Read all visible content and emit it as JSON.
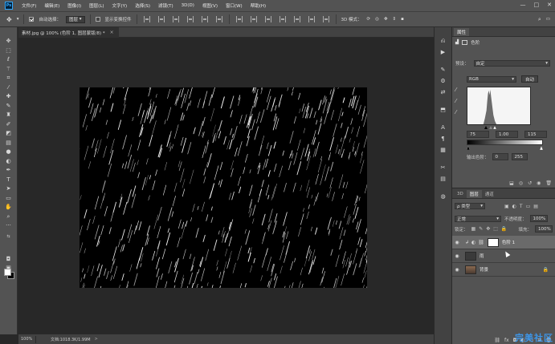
{
  "menubar": {
    "logo": "Ps",
    "items": [
      "文件(F)",
      "编辑(E)",
      "图像(I)",
      "图层(L)",
      "文字(Y)",
      "选择(S)",
      "滤镜(T)",
      "3D(D)",
      "视图(V)",
      "窗口(W)",
      "帮助(H)"
    ],
    "window_controls": [
      "—",
      "□",
      "✕"
    ]
  },
  "options": {
    "auto_select_label": "自动选择：",
    "auto_select_value": "图层",
    "show_transform_label": "显示变换控件",
    "mode_3d_label": "3D 模式："
  },
  "document": {
    "tab_title": "素材.jpg @ 100% (色阶 1, 图层蒙版/8) *",
    "close_glyph": "×"
  },
  "status": {
    "zoom": "100%",
    "doc_info": "文档:1018.3K/1.99M",
    "arrow": ">"
  },
  "properties": {
    "tab_label": "属性",
    "levels_title": "色阶",
    "preset_label": "预设：",
    "preset_value": "自定",
    "channel_value": "RGB",
    "auto_button": "自动",
    "input_black": "75",
    "input_gamma": "1.00",
    "input_white": "115",
    "output_label": "输出色阶：",
    "output_black": "0",
    "output_white": "255"
  },
  "layers": {
    "tabs": [
      "3D",
      "图层",
      "通道"
    ],
    "active_tab": 1,
    "filter_label": "ρ 类型",
    "blend_mode": "正常",
    "opacity_label": "不透明度：",
    "opacity_value": "100%",
    "lock_label": "锁定：",
    "fill_label": "填充：",
    "fill_value": "100%",
    "items": [
      {
        "name": "色阶 1",
        "selected": true
      },
      {
        "name": "雨",
        "selected": false
      },
      {
        "name": "背景",
        "selected": false
      }
    ]
  },
  "watermark": "完美社区",
  "colors": {
    "accent": "#31a8ff",
    "panel_bg": "#535353",
    "dark_bg": "#282828"
  }
}
